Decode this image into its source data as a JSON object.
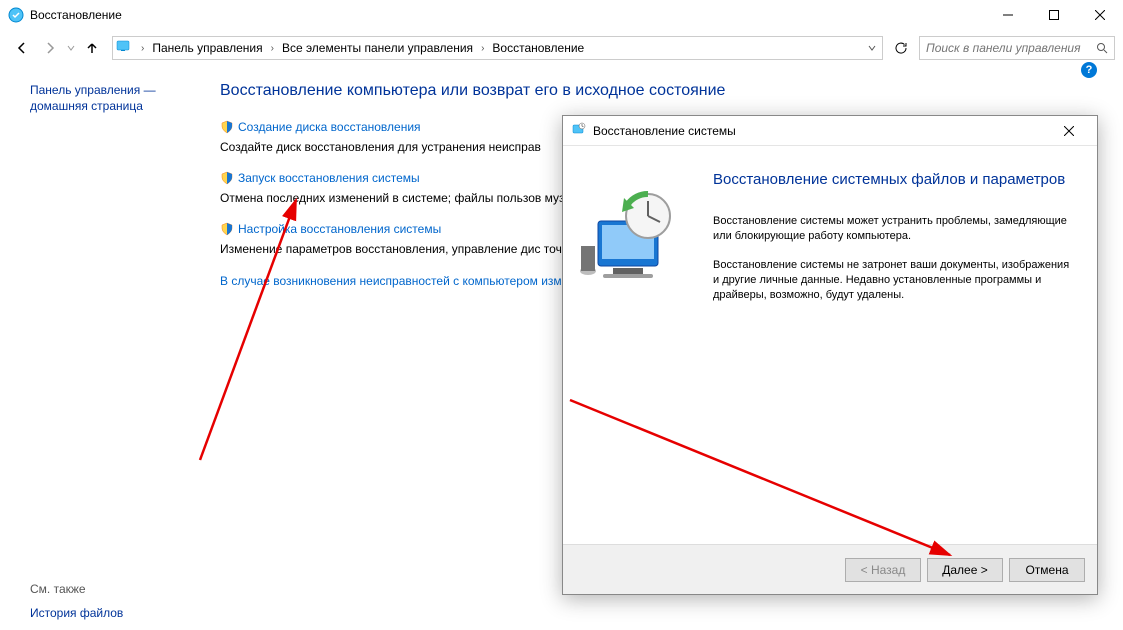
{
  "window": {
    "title": "Восстановление"
  },
  "breadcrumb": {
    "seg1": "Панель управления",
    "seg2": "Все элементы панели управления",
    "seg3": "Восстановление"
  },
  "search": {
    "placeholder": "Поиск в панели управления"
  },
  "sidebar": {
    "line1": "Панель управления —",
    "line2": "домашняя страница"
  },
  "main": {
    "heading": "Восстановление компьютера или возврат его в исходное состояние",
    "items": [
      {
        "link": "Создание диска восстановления",
        "desc": "Создайте диск восстановления для устранения неиспрaв"
      },
      {
        "link": "Запуск восстановления системы",
        "desc": "Отмена последних изменений в системе; файлы пользов музыка, остаются без изменений."
      },
      {
        "link": "Настройка восстановления системы",
        "desc": "Изменение параметров восстановления, управление дис точек восстановления."
      }
    ],
    "bottom_link": "В случае возникновения неисправностей с компьютером изменить их."
  },
  "see_also": {
    "title": "См. также",
    "link": "История файлов"
  },
  "dialog": {
    "title": "Восстановление системы",
    "heading": "Восстановление системных файлов и параметров",
    "para1": "Восстановление системы может устранить проблемы, замедляющие или блокирующие работу компьютера.",
    "para2": "Восстановление системы не затронет ваши документы, изображения и другие личные данные. Недавно установленные программы и драйверы, возможно, будут удалены.",
    "btn_back": "< Назад",
    "btn_next": "Далее >",
    "btn_cancel": "Отмена"
  }
}
